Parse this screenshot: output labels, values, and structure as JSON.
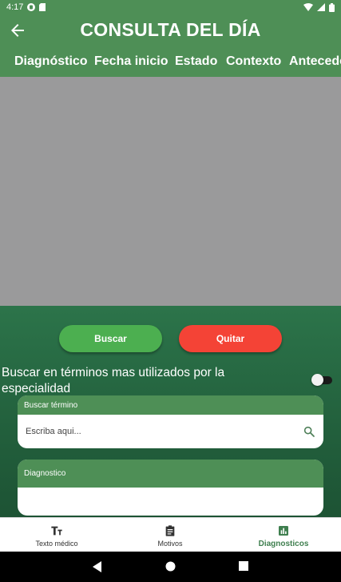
{
  "status_bar": {
    "time": "4:17"
  },
  "header": {
    "title": "CONSULTA DEL DÍA"
  },
  "tabs": [
    "Diagnóstico",
    "Fecha inicio",
    "Estado",
    "Contexto",
    "Antecedentes"
  ],
  "actions": {
    "search_label": "Buscar",
    "remove_label": "Quitar"
  },
  "toggle": {
    "label": "Buscar en términos mas utilizados por la especialidad",
    "checked": false
  },
  "search_card": {
    "title": "Buscar término",
    "placeholder": "Escriba aqui..."
  },
  "diagnosis_card": {
    "title": "Diagnostico"
  },
  "bottom_nav": {
    "items": [
      {
        "label": "Texto médico",
        "icon": "text-format-icon"
      },
      {
        "label": "Motivos",
        "icon": "clipboard-icon"
      },
      {
        "label": "Diagnosticos",
        "icon": "bar-chart-icon",
        "active": true
      }
    ]
  },
  "colors": {
    "primary": "#4e8f56",
    "success": "#4caf50",
    "danger": "#f44336",
    "placeholder_area": "#9a9a9b"
  }
}
